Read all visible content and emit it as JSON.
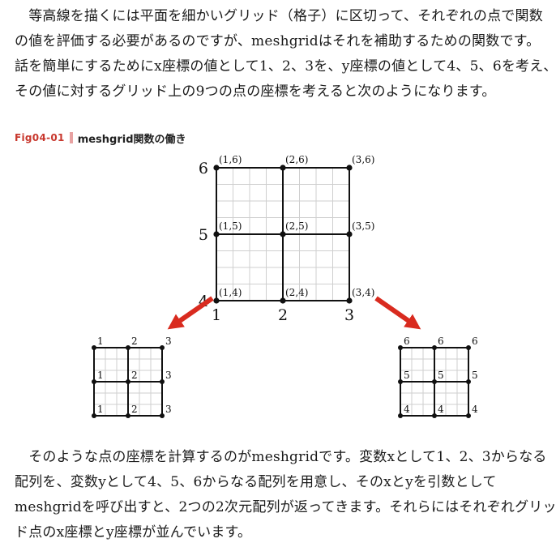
{
  "para1": [
    "　等高線を描くには平面を細かいグリッド（格子）に区切って、それぞれの点で関数",
    "の値を評価する必要があるのですが、meshgridはそれを補助するための関数です。",
    "話を簡単にするためにx座標の値として1、2、3を、y座標の値として4、5、6を考え、",
    "その値に対するグリッド上の9つの点の座標を考えると次のようになります。"
  ],
  "figure": {
    "number": "Fig04-01",
    "title": "meshgrid関数の働き",
    "x_ticks": [
      "1",
      "2",
      "3"
    ],
    "y_ticks": [
      "4",
      "5",
      "6"
    ],
    "points": [
      [
        "(1,6)",
        "(2,6)",
        "(3,6)"
      ],
      [
        "(1,5)",
        "(2,5)",
        "(3,5)"
      ],
      [
        "(1,4)",
        "(2,4)",
        "(3,4)"
      ]
    ],
    "x_grid_labels": [
      [
        "1",
        "2",
        "3"
      ],
      [
        "1",
        "2",
        "3"
      ],
      [
        "1",
        "2",
        "3"
      ]
    ],
    "y_grid_labels": [
      [
        "6",
        "6",
        "6"
      ],
      [
        "5",
        "5",
        "5"
      ],
      [
        "4",
        "4",
        "4"
      ]
    ],
    "arrow_color": "#d92b1f"
  },
  "para2": [
    "　そのような点の座標を計算するのがmeshgridです。変数xとして1、2、3からなる",
    "配列を、変数yとして4、5、6からなる配列を用意し、そのxとyを引数として",
    "meshgridを呼び出すと、2つの2次元配列が返ってきます。それらにはそれぞれグリッ",
    "ド点のx座標とy座標が並んでいます。"
  ]
}
